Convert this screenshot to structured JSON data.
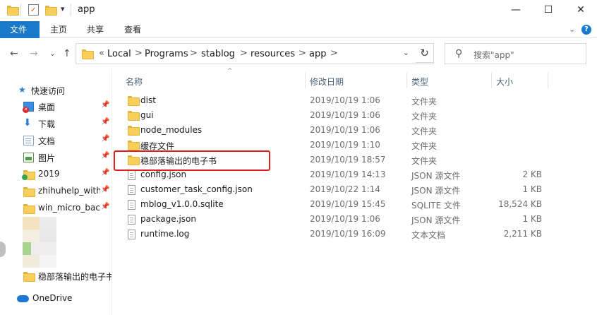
{
  "window": {
    "title": "app",
    "quick_access_dropdown": "▾",
    "minimize": "—",
    "maximize": "☐",
    "close": "✕"
  },
  "ribbon": {
    "tabs": [
      {
        "label": "文件",
        "active": true
      },
      {
        "label": "主页",
        "active": false
      },
      {
        "label": "共享",
        "active": false
      },
      {
        "label": "查看",
        "active": false
      }
    ],
    "expand_glyph": "⌄",
    "help_glyph": "?"
  },
  "nav": {
    "back": "←",
    "forward": "→",
    "recent": "⌄",
    "up": "↑",
    "path_prefix": "«",
    "breadcrumbs": [
      "Local",
      "Programs",
      "stablog",
      "resources",
      "app"
    ],
    "separator": ">",
    "address_dropdown": "⌄",
    "refresh": "↻",
    "search_placeholder": "搜索\"app\""
  },
  "navpane": {
    "quick_access": "快速访问",
    "items": [
      {
        "label": "桌面",
        "icon": "desktop-icon",
        "pinned": true
      },
      {
        "label": "下载",
        "icon": "download-icon",
        "pinned": true
      },
      {
        "label": "文档",
        "icon": "documents-icon",
        "pinned": true
      },
      {
        "label": "图片",
        "icon": "pictures-icon",
        "pinned": true
      },
      {
        "label": "2019",
        "icon": "folder-icon",
        "pinned": true
      },
      {
        "label": "zhihuhelp_with_",
        "icon": "folder-icon",
        "pinned": true
      },
      {
        "label": "win_micro_back",
        "icon": "folder-icon",
        "pinned": true
      }
    ],
    "extra_folder": "稳部落输出的电子书",
    "onedrive": "OneDrive",
    "pin_glyph": "📌"
  },
  "columns": {
    "name": "名称",
    "date": "修改日期",
    "type": "类型",
    "size": "大小",
    "sort_glyph": "^"
  },
  "files": [
    {
      "name": "dist",
      "date": "2019/10/19 1:06",
      "type": "文件夹",
      "size": "",
      "kind": "folder"
    },
    {
      "name": "gui",
      "date": "2019/10/19 1:06",
      "type": "文件夹",
      "size": "",
      "kind": "folder"
    },
    {
      "name": "node_modules",
      "date": "2019/10/19 1:06",
      "type": "文件夹",
      "size": "",
      "kind": "folder"
    },
    {
      "name": "缓存文件",
      "date": "2019/10/19 1:10",
      "type": "文件夹",
      "size": "",
      "kind": "folder"
    },
    {
      "name": "稳部落输出的电子书",
      "date": "2019/10/19 18:57",
      "type": "文件夹",
      "size": "",
      "kind": "folder"
    },
    {
      "name": "config.json",
      "date": "2019/10/19 14:13",
      "type": "JSON 源文件",
      "size": "2 KB",
      "kind": "file"
    },
    {
      "name": "customer_task_config.json",
      "date": "2019/10/22 1:14",
      "type": "JSON 源文件",
      "size": "1 KB",
      "kind": "file"
    },
    {
      "name": "mblog_v1.0.0.sqlite",
      "date": "2019/10/19 15:45",
      "type": "SQLITE 文件",
      "size": "18,524 KB",
      "kind": "file"
    },
    {
      "name": "package.json",
      "date": "2019/10/19 1:06",
      "type": "JSON 源文件",
      "size": "1 KB",
      "kind": "file"
    },
    {
      "name": "runtime.log",
      "date": "2019/10/19 16:09",
      "type": "文本文档",
      "size": "2,211 KB",
      "kind": "file"
    }
  ],
  "colors": {
    "accent": "#1979ca",
    "highlight": "#e21d1d",
    "folder": "#f7cf5a"
  }
}
